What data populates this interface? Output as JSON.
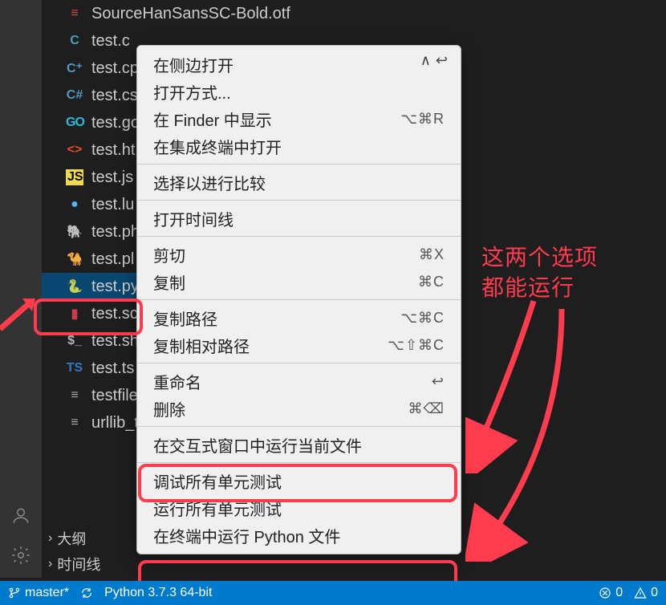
{
  "files": [
    {
      "icon": "≡",
      "iconClass": "ic-font",
      "name": "SourceHanSansSC-Bold.otf"
    },
    {
      "icon": "C",
      "iconClass": "ic-c",
      "name": "test.c"
    },
    {
      "icon": "C⁺",
      "iconClass": "ic-cpp",
      "name": "test.cp"
    },
    {
      "icon": "C#",
      "iconClass": "ic-cs",
      "name": "test.cs"
    },
    {
      "icon": "GO",
      "iconClass": "ic-go",
      "name": "test.go"
    },
    {
      "icon": "<>",
      "iconClass": "ic-html",
      "name": "test.ht"
    },
    {
      "icon": "JS",
      "iconClass": "ic-js",
      "name": "test.js"
    },
    {
      "icon": "●",
      "iconClass": "ic-lua",
      "name": "test.lu"
    },
    {
      "icon": "🐘",
      "iconClass": "ic-php",
      "name": "test.ph"
    },
    {
      "icon": "🐪",
      "iconClass": "ic-pl",
      "name": "test.pl"
    },
    {
      "icon": "🐍",
      "iconClass": "ic-py",
      "name": "test.py",
      "selected": true
    },
    {
      "icon": "▮",
      "iconClass": "ic-sc",
      "name": "test.sc"
    },
    {
      "icon": "$_",
      "iconClass": "ic-sh",
      "name": "test.sh"
    },
    {
      "icon": "TS",
      "iconClass": "ic-ts",
      "name": "test.ts"
    },
    {
      "icon": "≡",
      "iconClass": "ic-txt",
      "name": "testfile"
    },
    {
      "icon": "≡",
      "iconClass": "ic-url",
      "name": "urllib_t"
    }
  ],
  "sections": {
    "outline": "大纲",
    "timeline": "时间线"
  },
  "menu": {
    "groups": [
      [
        {
          "label": "在侧边打开",
          "shortcut": ""
        },
        {
          "label": "打开方式...",
          "shortcut": ""
        },
        {
          "label": "在 Finder 中显示",
          "shortcut": "⌥⌘R"
        },
        {
          "label": "在集成终端中打开",
          "shortcut": ""
        }
      ],
      [
        {
          "label": "选择以进行比较",
          "shortcut": ""
        }
      ],
      [
        {
          "label": "打开时间线",
          "shortcut": ""
        }
      ],
      [
        {
          "label": "剪切",
          "shortcut": "⌘X"
        },
        {
          "label": "复制",
          "shortcut": "⌘C"
        }
      ],
      [
        {
          "label": "复制路径",
          "shortcut": "⌥⌘C"
        },
        {
          "label": "复制相对路径",
          "shortcut": "⌥⇧⌘C"
        }
      ],
      [
        {
          "label": "重命名",
          "shortcut": "↩"
        },
        {
          "label": "删除",
          "shortcut": "⌘⌫"
        }
      ],
      [
        {
          "label": "在交互式窗口中运行当前文件",
          "shortcut": ""
        }
      ],
      [
        {
          "label": "调试所有单元测试",
          "shortcut": ""
        },
        {
          "label": "运行所有单元测试",
          "shortcut": ""
        },
        {
          "label": "在终端中运行 Python 文件",
          "shortcut": ""
        }
      ]
    ]
  },
  "annotation": {
    "line1": "这两个选项",
    "line2": "都能运行"
  },
  "statusbar": {
    "branch": "master*",
    "sync": "",
    "python": "Python 3.7.3 64-bit",
    "errors": "0",
    "warnings": "0"
  }
}
